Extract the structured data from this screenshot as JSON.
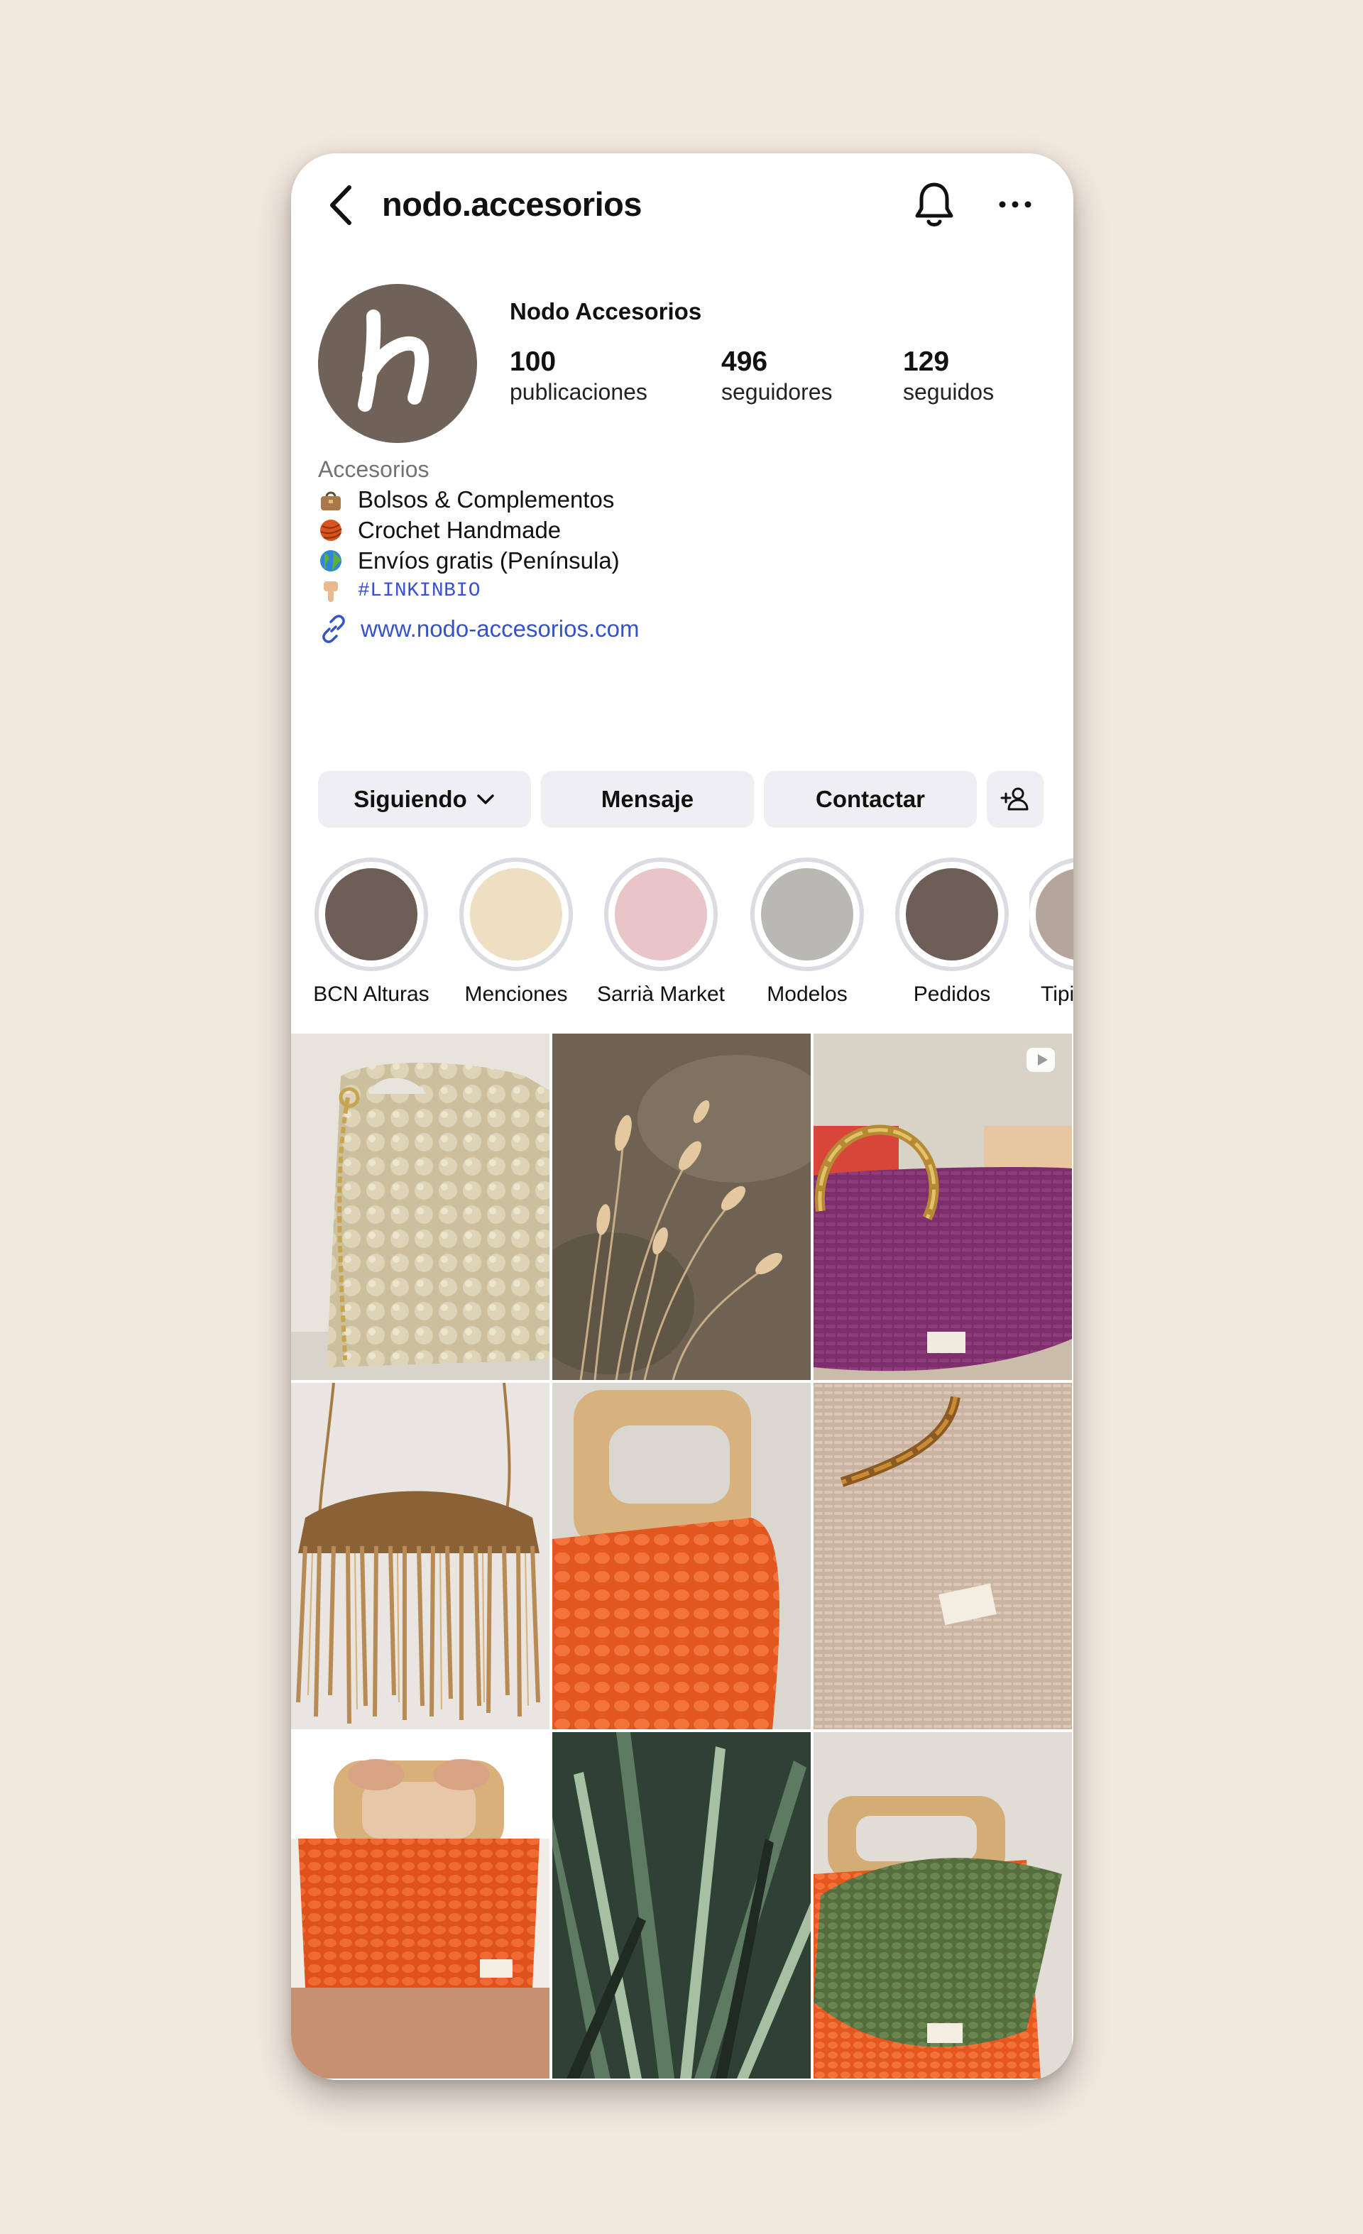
{
  "header": {
    "username": "nodo.accesorios"
  },
  "profile": {
    "display_name": "Nodo Accesorios",
    "avatar_letter": "n",
    "stats": [
      {
        "value": "100",
        "label": "publicaciones"
      },
      {
        "value": "496",
        "label": "seguidores"
      },
      {
        "value": "129",
        "label": "seguidos"
      }
    ],
    "category": "Accesorios",
    "bio": [
      {
        "icon": "handbag-icon",
        "text": "Bolsos & Complementos"
      },
      {
        "icon": "yarn-ball-icon",
        "text": "Crochet Handmade"
      },
      {
        "icon": "globe-icon",
        "text": "Envíos gratis (Península)"
      },
      {
        "icon": "pointing-down-icon",
        "text": "#LINKINBIO"
      }
    ],
    "website": "www.nodo-accesorios.com"
  },
  "actions": {
    "following": "Siguiendo",
    "message": "Mensaje",
    "contact": "Contactar"
  },
  "highlights": [
    {
      "name": "BCN Alturas",
      "color": "#6d5f57"
    },
    {
      "name": "Menciones",
      "color": "#eedfc3"
    },
    {
      "name": "Sarrià Market",
      "color": "#e8c5c9"
    },
    {
      "name": "Modelos",
      "color": "#b9b8b4"
    },
    {
      "name": "Pedidos",
      "color": "#6d5f57"
    },
    {
      "name": "Tipi",
      "color": "#b4a69c"
    }
  ],
  "posts": [
    {
      "subject": "beige crochet bag with gold chain"
    },
    {
      "subject": "dried grass stems"
    },
    {
      "subject": "purple raffia bag with bamboo handle",
      "reel": true
    },
    {
      "subject": "gold fringe bag"
    },
    {
      "subject": "orange crochet bag with wooden handle"
    },
    {
      "subject": "beige raffia bag with bamboo handle"
    },
    {
      "subject": "orange bag held by person"
    },
    {
      "subject": "green leaves"
    },
    {
      "subject": "orange and green crochet bags"
    }
  ]
}
